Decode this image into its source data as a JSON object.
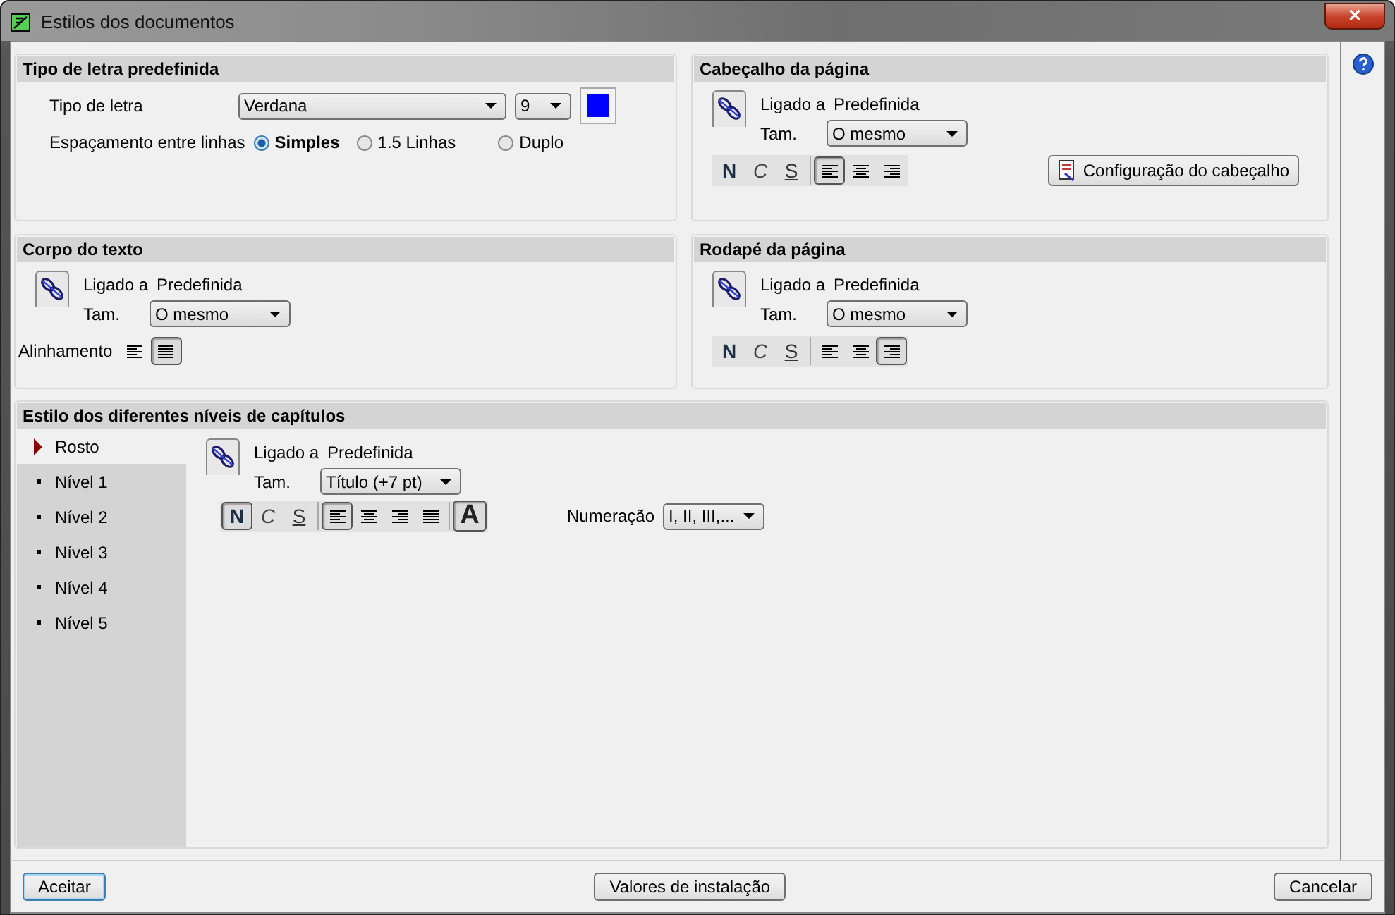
{
  "window": {
    "title": "Estilos dos documentos",
    "close": "✕"
  },
  "default_font": {
    "title": "Tipo de letra predefinida",
    "font_label": "Tipo de letra",
    "font_value": "Verdana",
    "size_value": "9",
    "color": "#0000ff",
    "spacing_label": "Espaçamento entre linhas",
    "spacing_options": [
      {
        "label": "Simples",
        "selected": true
      },
      {
        "label": "1.5 Linhas",
        "selected": false
      },
      {
        "label": "Duplo",
        "selected": false
      }
    ]
  },
  "header": {
    "title": "Cabeçalho da página",
    "linked_label": "Ligado a",
    "linked_value": "Predefinida",
    "size_label": "Tam.",
    "size_value": "O mesmo",
    "styles": [
      {
        "kind": "bold",
        "label": "N",
        "on": false
      },
      {
        "kind": "italic",
        "label": "C",
        "on": false
      },
      {
        "kind": "underline",
        "label": "S",
        "on": false
      }
    ],
    "align": [
      {
        "kind": "left",
        "selected": true
      },
      {
        "kind": "center",
        "selected": false
      },
      {
        "kind": "right",
        "selected": false
      }
    ],
    "config_button": "Configuração do cabeçalho"
  },
  "body": {
    "title": "Corpo do texto",
    "linked_label": "Ligado a",
    "linked_value": "Predefinida",
    "size_label": "Tam.",
    "size_value": "O mesmo",
    "align_label": "Alinhamento",
    "align": [
      {
        "kind": "left",
        "selected": false
      },
      {
        "kind": "justify",
        "selected": true
      }
    ]
  },
  "footer": {
    "title": "Rodapé da página",
    "linked_label": "Ligado a",
    "linked_value": "Predefinida",
    "size_label": "Tam.",
    "size_value": "O mesmo",
    "styles": [
      {
        "kind": "bold",
        "label": "N",
        "on": false
      },
      {
        "kind": "italic",
        "label": "C",
        "on": false
      },
      {
        "kind": "underline",
        "label": "S",
        "on": false
      }
    ],
    "align": [
      {
        "kind": "left",
        "selected": false
      },
      {
        "kind": "center",
        "selected": false
      },
      {
        "kind": "right",
        "selected": true
      }
    ]
  },
  "chapters": {
    "title": "Estilo dos diferentes níveis de capítulos",
    "levels": [
      {
        "label": "Rosto",
        "selected": true
      },
      {
        "label": "Nível 1",
        "selected": false
      },
      {
        "label": "Nível 2",
        "selected": false
      },
      {
        "label": "Nível 3",
        "selected": false
      },
      {
        "label": "Nível 4",
        "selected": false
      },
      {
        "label": "Nível 5",
        "selected": false
      }
    ],
    "linked_label": "Ligado a",
    "linked_value": "Predefinida",
    "size_label": "Tam.",
    "size_value": "Título (+7  pt)",
    "styles": [
      {
        "kind": "bold",
        "label": "N",
        "on": true
      },
      {
        "kind": "italic",
        "label": "C",
        "on": false
      },
      {
        "kind": "underline",
        "label": "S",
        "on": false
      }
    ],
    "align": [
      {
        "kind": "left",
        "selected": true
      },
      {
        "kind": "center",
        "selected": false
      },
      {
        "kind": "right",
        "selected": false
      },
      {
        "kind": "justify",
        "selected": false
      }
    ],
    "caps": {
      "label": "A",
      "on": true
    },
    "numbering_label": "Numeração",
    "numbering_value": "I, II, III,..."
  },
  "buttons": {
    "accept": "Aceitar",
    "defaults": "Valores de instalação",
    "cancel": "Cancelar"
  }
}
